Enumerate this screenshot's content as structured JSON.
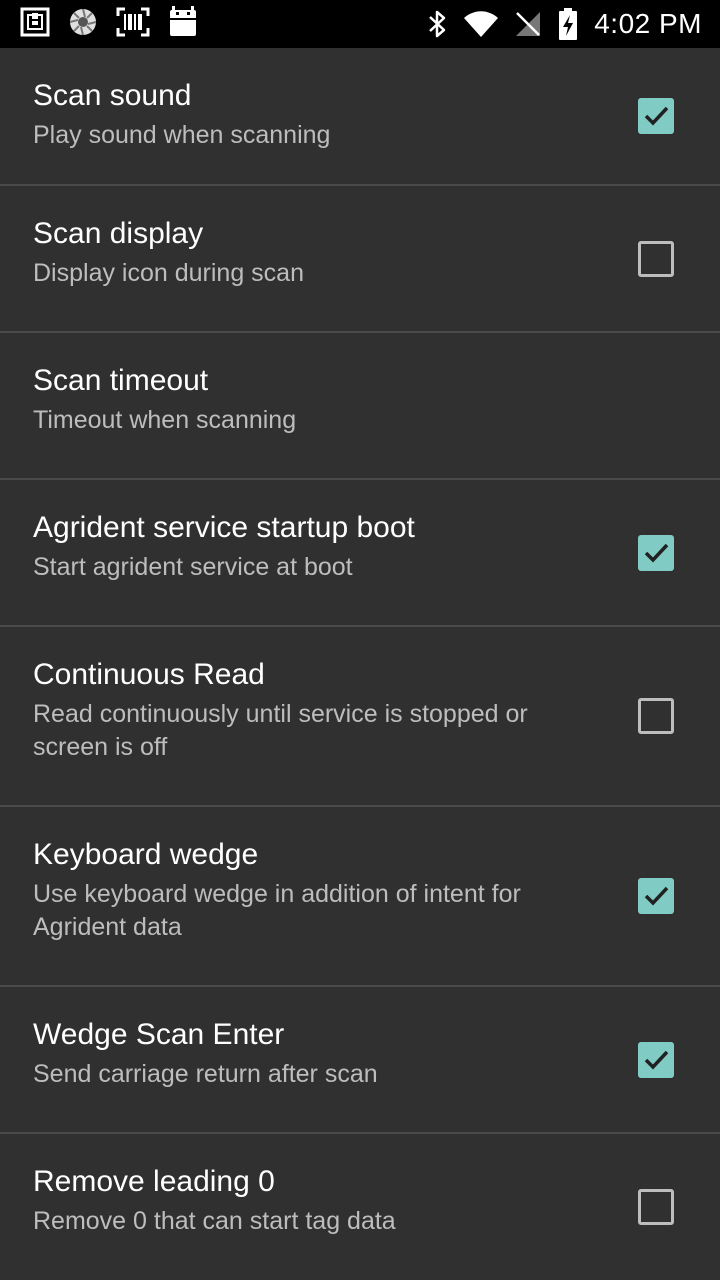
{
  "status_bar": {
    "time": "4:02 PM",
    "left_icons": [
      "sim-app-icon",
      "aperture-icon",
      "barcode-scanner-icon",
      "android-icon"
    ],
    "right_icons": [
      "bluetooth-icon",
      "wifi-icon",
      "no-signal-icon",
      "battery-charging-icon"
    ]
  },
  "colors": {
    "background": "#303030",
    "accent": "#80cbc4",
    "divider": "#4a4a4a"
  },
  "settings": [
    {
      "title": "Scan sound",
      "summary": "Play sound when scanning",
      "checkbox": "checked"
    },
    {
      "title": "Scan display",
      "summary": "Display icon during scan",
      "checkbox": "unchecked"
    },
    {
      "title": "Scan timeout",
      "summary": "Timeout when scanning",
      "checkbox": "none"
    },
    {
      "title": "Agrident service startup boot",
      "summary": "Start agrident service at boot",
      "checkbox": "checked"
    },
    {
      "title": "Continuous Read",
      "summary": "Read continuously until service is stopped or screen is off",
      "checkbox": "unchecked"
    },
    {
      "title": "Keyboard wedge",
      "summary": "Use keyboard wedge in addition of intent for Agrident data",
      "checkbox": "checked"
    },
    {
      "title": "Wedge Scan Enter",
      "summary": "Send carriage return after scan",
      "checkbox": "checked"
    },
    {
      "title": "Remove leading 0",
      "summary": "Remove 0 that can start tag data",
      "checkbox": "unchecked"
    }
  ]
}
